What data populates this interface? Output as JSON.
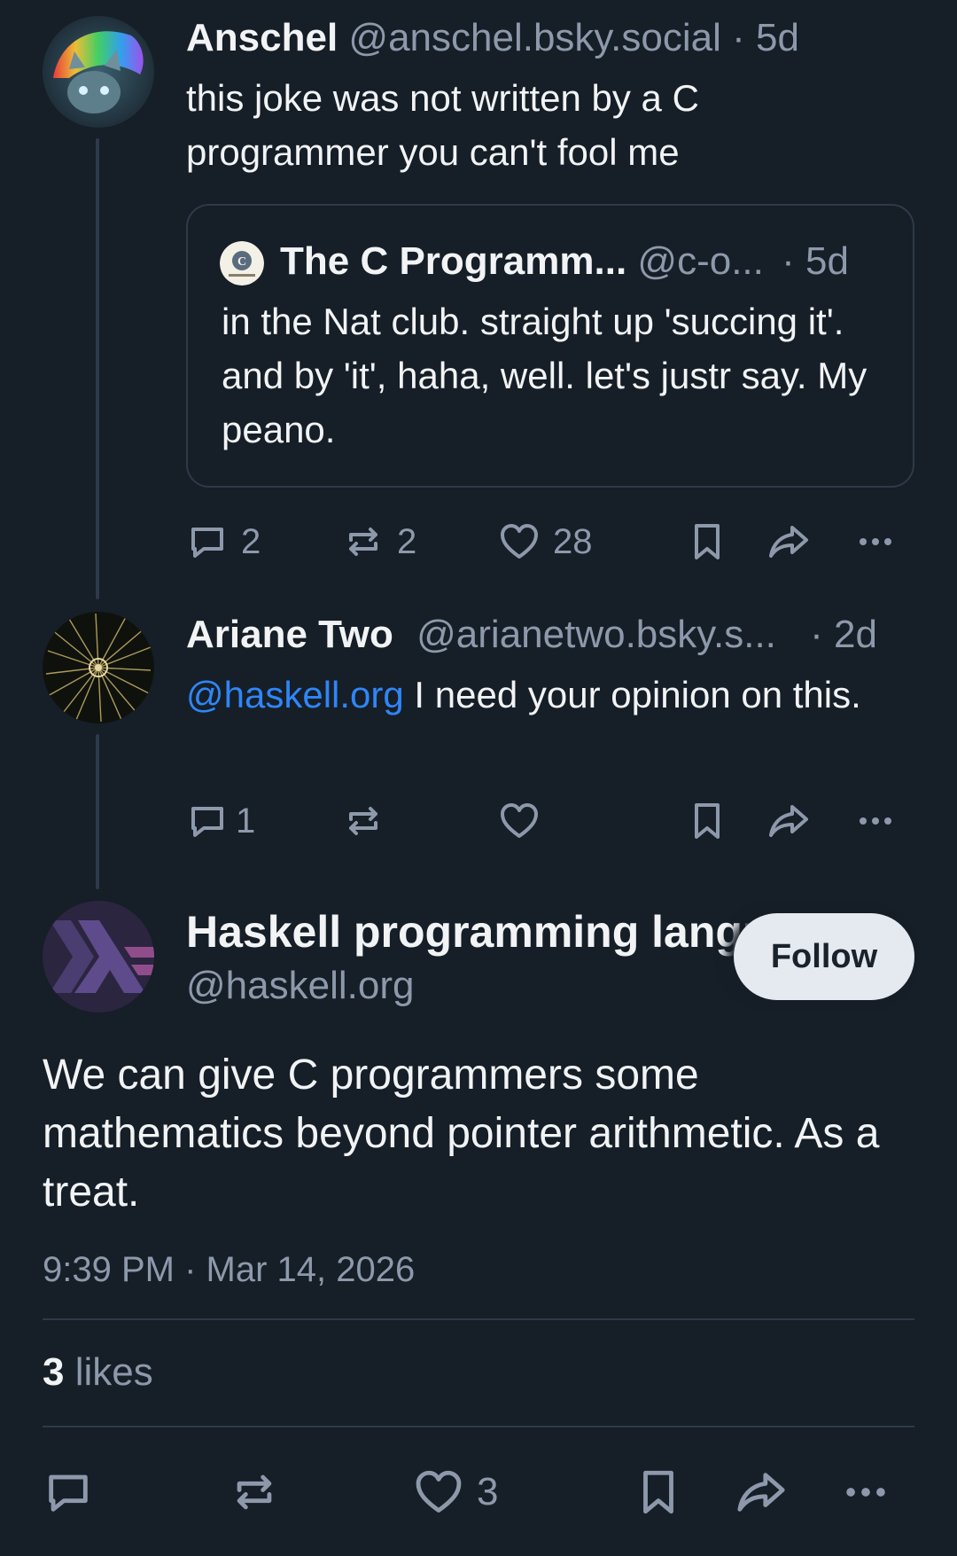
{
  "thread": {
    "post1": {
      "author_name": "Anschel",
      "handle": "@anschel.bsky.social",
      "separator": "·",
      "time": "5d",
      "text": "this joke was not written by a C programmer you can't fool me",
      "quote": {
        "author_name": "The C Programm...",
        "handle": "@c-o...",
        "separator": "·",
        "time": "5d",
        "text": "in the Nat club. straight up 'succing it'. and by 'it', haha, well. let's justr say. My peano.",
        "avatar_text": "C"
      },
      "actions": {
        "reply_count": "2",
        "repost_count": "2",
        "like_count": "28"
      }
    },
    "post2": {
      "author_name": "Ariane Two",
      "handle": "@arianetwo.bsky.s...",
      "separator": "·",
      "time": "2d",
      "mention": "@haskell.org",
      "text": " I need your opinion on this.",
      "actions": {
        "reply_count": "1"
      }
    },
    "main_post": {
      "author_name": "Haskell programming language",
      "handle": "@haskell.org",
      "follow_label": "Follow",
      "text": "We can give C programmers some mathematics beyond pointer arithmetic. As a treat.",
      "timestamp": "9:39 PM · Mar 14, 2026",
      "likes_count": "3",
      "likes_label": "likes",
      "actions": {
        "like_count": "3"
      }
    }
  },
  "colors": {
    "background": "#161e27",
    "muted": "#8d99ab",
    "divider": "#2e3a49",
    "mention": "#2f86f6",
    "follow_button": "#e5e9f0"
  }
}
